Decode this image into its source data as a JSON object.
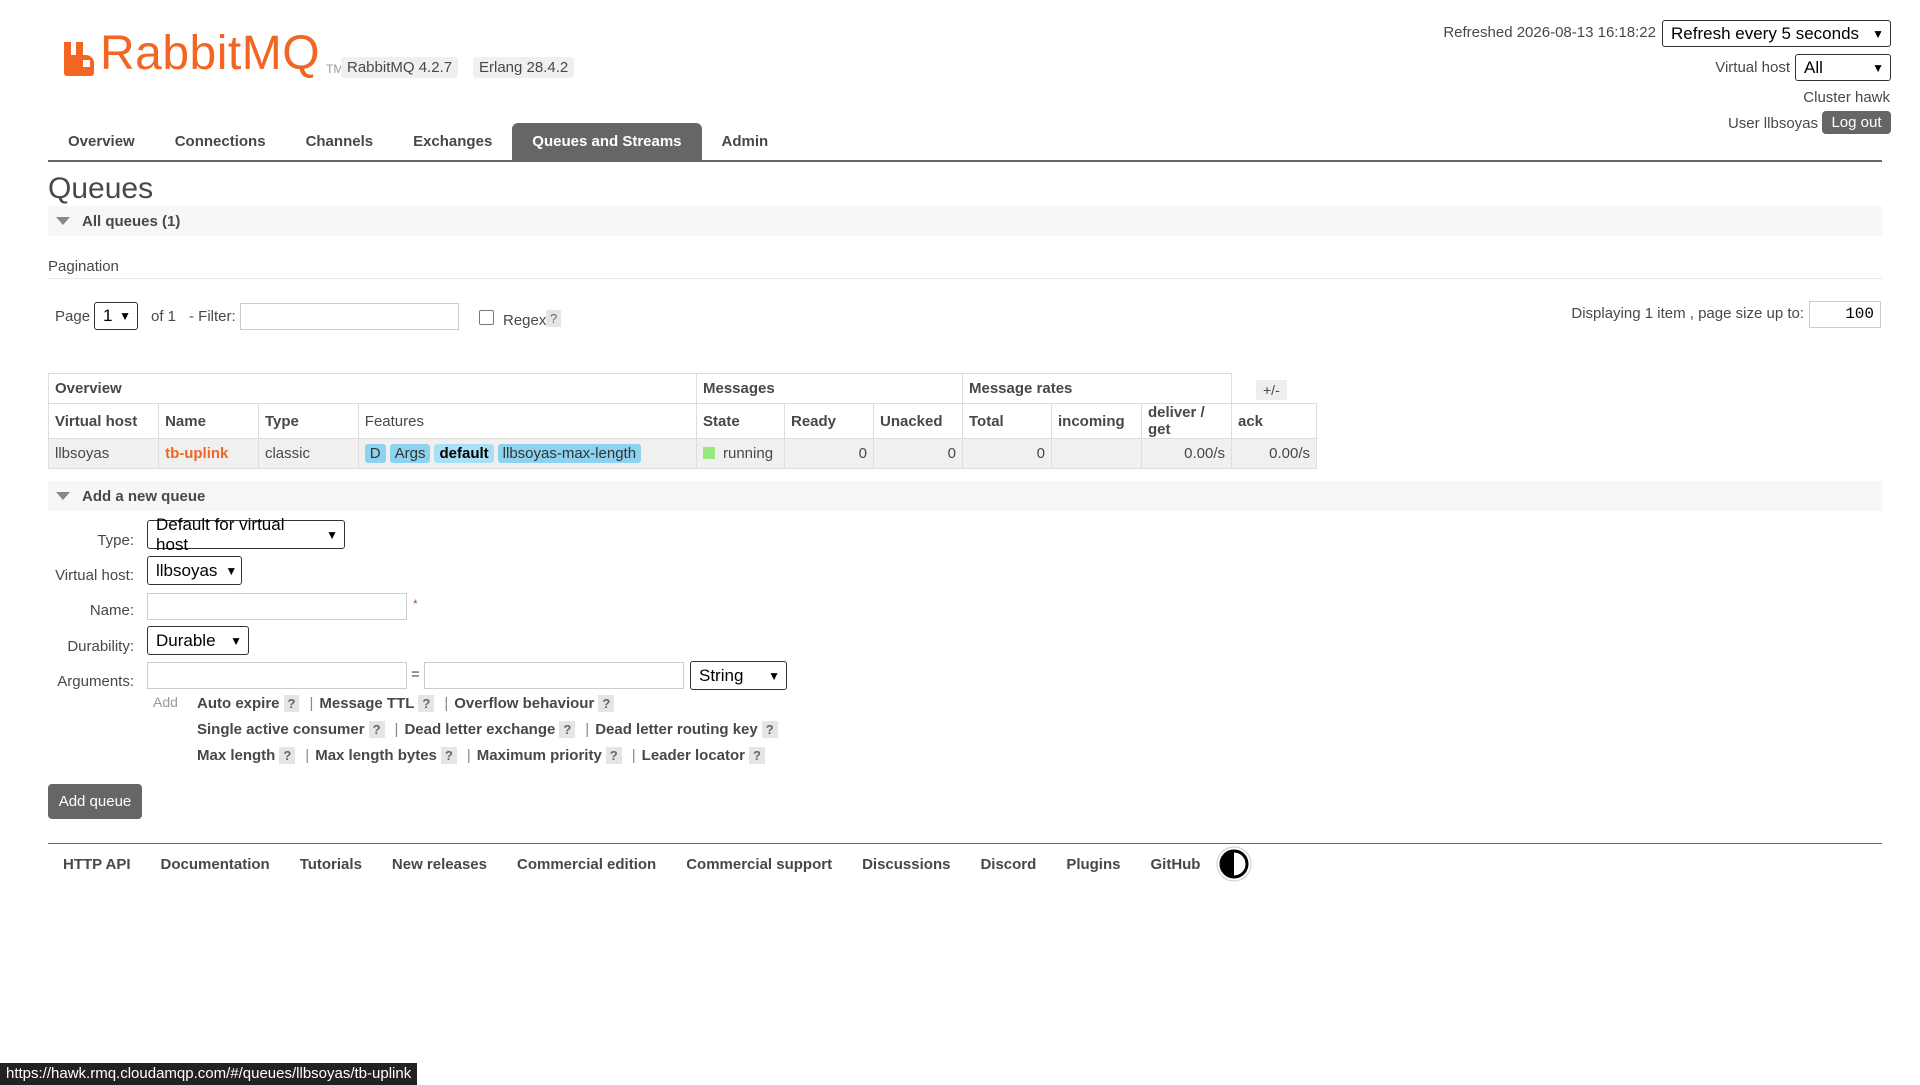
{
  "header": {
    "logo_text": "RabbitMQ",
    "logo_tm": "TM",
    "version_badge": "RabbitMQ 4.2.7",
    "erlang_badge": "Erlang 28.4.2",
    "refreshed_text": "Refreshed 2026-08-13 16:18:22",
    "refresh_select": "Refresh every 5 seconds",
    "vhost_label": "Virtual host",
    "vhost_select": "All",
    "cluster_text": "Cluster hawk",
    "user_text": "User llbsoyas",
    "logout_label": "Log out"
  },
  "tabs": [
    "Overview",
    "Connections",
    "Channels",
    "Exchanges",
    "Queues and Streams",
    "Admin"
  ],
  "page_title": "Queues",
  "all_queues": {
    "section_title": "All queues (1)",
    "pagination_label": "Pagination",
    "page_label": "Page",
    "page_value": "1",
    "of_label": "of 1",
    "filter_label": "- Filter:",
    "filter_value": "",
    "regex_label": "Regex",
    "help": "?",
    "displaying_text": "Displaying 1 item , page size up to:",
    "page_size": "100"
  },
  "table": {
    "groups": [
      "Overview",
      "Messages",
      "Message rates"
    ],
    "plus_minus": "+/-",
    "headers": [
      "Virtual host",
      "Name",
      "Type",
      "Features",
      "State",
      "Ready",
      "Unacked",
      "Total",
      "incoming",
      "deliver / get",
      "ack"
    ],
    "rows": [
      {
        "vhost": "llbsoyas",
        "name": "tb-uplink",
        "type": "classic",
        "features": [
          "D",
          "Args",
          "default",
          "llbsoyas-max-length"
        ],
        "state": "running",
        "ready": "0",
        "unacked": "0",
        "total": "0",
        "incoming": "",
        "deliver_get": "0.00/s",
        "ack": "0.00/s"
      }
    ]
  },
  "add_queue": {
    "section_title": "Add a new queue",
    "type_label": "Type:",
    "type_value": "Default for virtual host",
    "vhost_label": "Virtual host:",
    "vhost_value": "llbsoyas",
    "name_label": "Name:",
    "name_value": "",
    "required_mark": "*",
    "durability_label": "Durability:",
    "durability_value": "Durable",
    "arguments_label": "Arguments:",
    "arg_equals": "=",
    "arg_type_value": "String",
    "add_label": "Add",
    "arg_links_row1": [
      "Auto expire",
      "Message TTL",
      "Overflow behaviour"
    ],
    "arg_links_row2": [
      "Single active consumer",
      "Dead letter exchange",
      "Dead letter routing key"
    ],
    "arg_links_row3": [
      "Max length",
      "Max length bytes",
      "Maximum priority",
      "Leader locator"
    ],
    "separator": "|",
    "submit_label": "Add queue"
  },
  "footer_links": [
    "HTTP API",
    "Documentation",
    "Tutorials",
    "New releases",
    "Commercial edition",
    "Commercial support",
    "Discussions",
    "Discord",
    "Plugins",
    "GitHub"
  ],
  "status_url": "https://hawk.rmq.cloudamqp.com/#/queues/llbsoyas/tb-uplink",
  "colors": {
    "brand": "#f26522",
    "tab_active": "#666666",
    "feature_badge": "#8dd3f0",
    "running": "#98e87f"
  }
}
